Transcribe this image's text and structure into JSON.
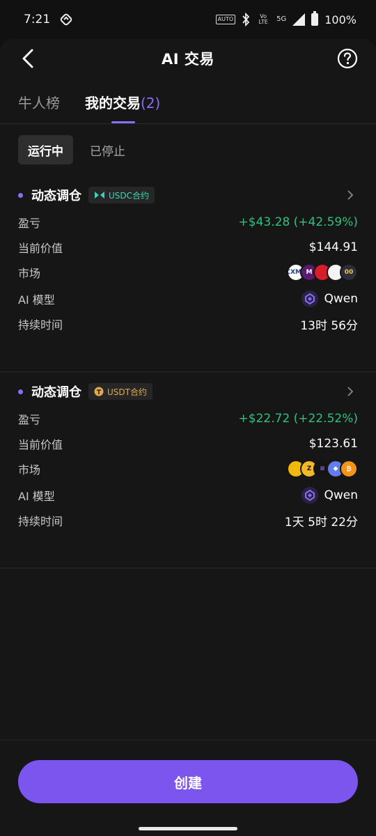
{
  "status": {
    "time": "7:21",
    "auto_label": "AUTO",
    "network": "5G",
    "volte": "Vo LTE",
    "battery": "100%"
  },
  "header": {
    "title": "AI 交易"
  },
  "tabs": {
    "leaderboard": "牛人榜",
    "my_trades": "我的交易",
    "my_trades_count": "(2)"
  },
  "subtabs": {
    "running": "运行中",
    "stopped": "已停止"
  },
  "labels": {
    "pnl": "盈亏",
    "current_value": "当前价值",
    "market": "市场",
    "ai_model": "AI 模型",
    "duration": "持续时间"
  },
  "trades": [
    {
      "title": "动态调仓",
      "badge": "USDC合约",
      "pnl": "+$43.28 (+42.59%)",
      "current_value": "$144.91",
      "model": "Qwen",
      "duration": "13时 56分",
      "market_coins": [
        {
          "icon": "coin-cxms",
          "text": "CXMS",
          "color": "#ffffff",
          "fg": "#1a3f8f"
        },
        {
          "icon": "coin-m",
          "text": "M",
          "color": "#5a1a6e",
          "fg": "#ffffff"
        },
        {
          "icon": "coin-red",
          "text": "",
          "color": "#d81e2a",
          "fg": "#ffffff"
        },
        {
          "icon": "coin-bird",
          "text": "",
          "color": "#f4f4f4",
          "fg": "#d81e2a"
        },
        {
          "icon": "coin-00",
          "text": "00",
          "color": "#2b2f3a",
          "fg": "#f2c84b"
        }
      ]
    },
    {
      "title": "动态调仓",
      "badge": "USDT合约",
      "pnl": "+$22.72 (+22.52%)",
      "current_value": "$123.61",
      "model": "Qwen",
      "duration": "1天 5时 22分",
      "market_coins": [
        {
          "icon": "coin-bnb",
          "text": "",
          "color": "#f0b90b",
          "fg": "#ffffff"
        },
        {
          "icon": "coin-z",
          "text": "Z",
          "color": "#f4b728",
          "fg": "#1a1a1a"
        },
        {
          "icon": "coin-sol",
          "text": "≡",
          "color": "#141414",
          "fg": "#9a6cf0"
        },
        {
          "icon": "coin-eth",
          "text": "◆",
          "color": "#627eea",
          "fg": "#ffffff"
        },
        {
          "icon": "coin-btc",
          "text": "₿",
          "color": "#f7931a",
          "fg": "#ffffff"
        }
      ]
    }
  ],
  "footer": {
    "create_label": "创建"
  },
  "colors": {
    "accent": "#7b55ee",
    "positive": "#2ec27e",
    "usdc": "#3ed3b6",
    "usdt": "#e3a94c"
  }
}
